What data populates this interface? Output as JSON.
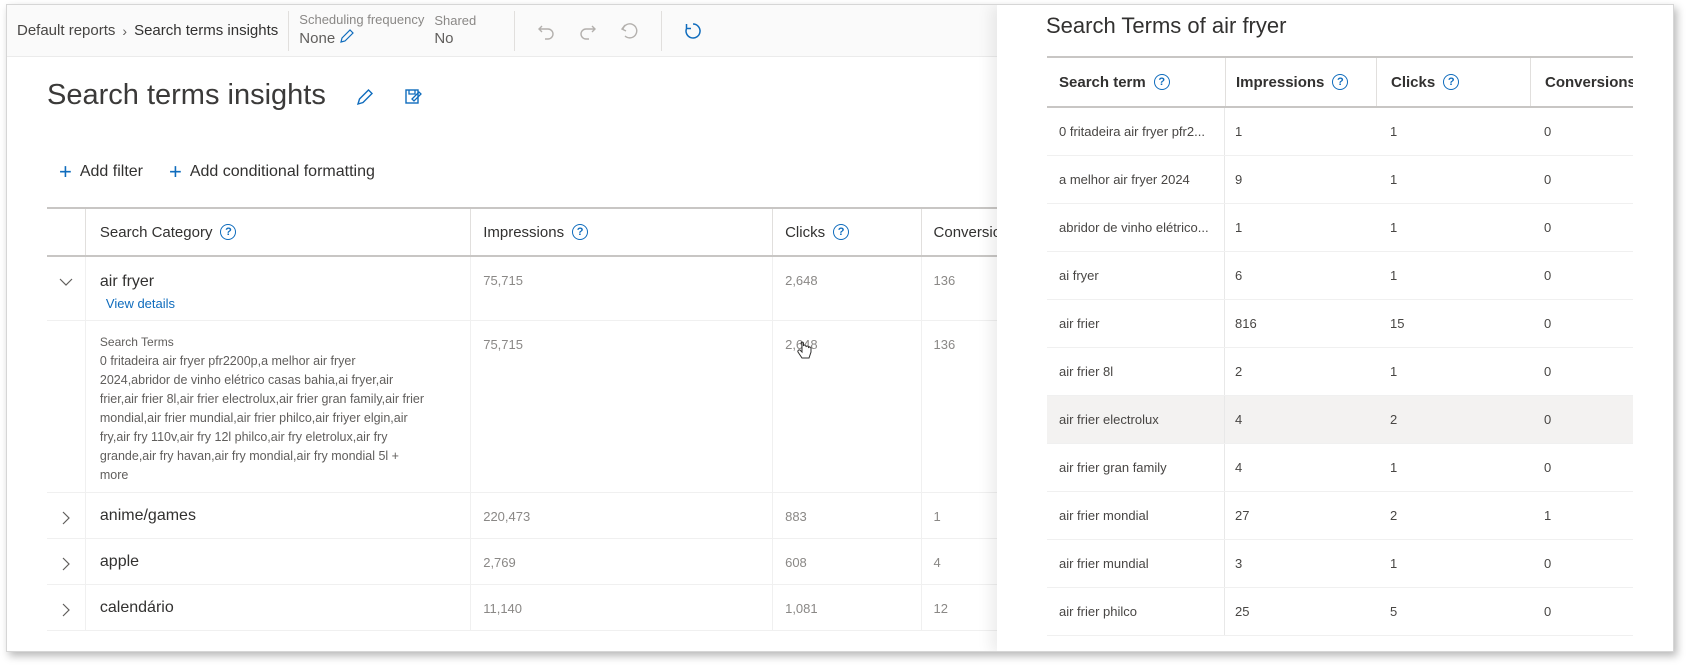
{
  "breadcrumb": {
    "parent": "Default reports",
    "current": "Search terms insights"
  },
  "scheduling": {
    "label": "Scheduling frequency",
    "value": "None"
  },
  "shared": {
    "label": "Shared",
    "value": "No"
  },
  "page": {
    "title": "Search terms insights"
  },
  "actions": {
    "add_filter": "Add filter",
    "add_conditional": "Add conditional formatting"
  },
  "grid": {
    "headers": {
      "category": "Search Category",
      "impressions": "Impressions",
      "clicks": "Clicks",
      "conversions": "Conversions"
    },
    "rows": [
      {
        "category": "air fryer",
        "view_details": "View details",
        "impressions": "75,715",
        "clicks": "2,648",
        "conversions": "136"
      },
      {
        "category": "anime/games",
        "impressions": "220,473",
        "clicks": "883",
        "conversions": "1"
      },
      {
        "category": "apple",
        "impressions": "2,769",
        "clicks": "608",
        "conversions": "4"
      },
      {
        "category": "calendário",
        "impressions": "11,140",
        "clicks": "1,081",
        "conversions": "12"
      }
    ],
    "expanded": {
      "title": "Search Terms",
      "text": "0 fritadeira air fryer pfr2200p,a melhor air fryer 2024,abridor de vinho elétrico casas bahia,ai fryer,air frier,air frier 8l,air frier electrolux,air frier gran family,air frier mondial,air frier mundial,air frier philco,air friyer elgin,air fry,air fry 110v,air fry 12l philco,air fry eletrolux,air fry grande,air fry havan,air fry mondial,air fry mondial 5l + more",
      "impressions": "75,715",
      "clicks": "2,648",
      "conversions": "136"
    }
  },
  "panel": {
    "title": "Search Terms of air fryer",
    "headers": {
      "term": "Search term",
      "impressions": "Impressions",
      "clicks": "Clicks",
      "conversions": "Conversions"
    },
    "rows": [
      {
        "term": "0 fritadeira air fryer pfr2...",
        "impressions": "1",
        "clicks": "1",
        "conversions": "0"
      },
      {
        "term": "a melhor air fryer 2024",
        "impressions": "9",
        "clicks": "1",
        "conversions": "0"
      },
      {
        "term": "abridor de vinho elétrico...",
        "impressions": "1",
        "clicks": "1",
        "conversions": "0"
      },
      {
        "term": "ai fryer",
        "impressions": "6",
        "clicks": "1",
        "conversions": "0"
      },
      {
        "term": "air frier",
        "impressions": "816",
        "clicks": "15",
        "conversions": "0"
      },
      {
        "term": "air frier 8l",
        "impressions": "2",
        "clicks": "1",
        "conversions": "0"
      },
      {
        "term": "air frier electrolux",
        "impressions": "4",
        "clicks": "2",
        "conversions": "0"
      },
      {
        "term": "air frier gran family",
        "impressions": "4",
        "clicks": "1",
        "conversions": "0"
      },
      {
        "term": "air frier mondial",
        "impressions": "27",
        "clicks": "2",
        "conversions": "1"
      },
      {
        "term": "air frier mundial",
        "impressions": "3",
        "clicks": "1",
        "conversions": "0"
      },
      {
        "term": "air frier philco",
        "impressions": "25",
        "clicks": "5",
        "conversions": "0"
      }
    ]
  },
  "colors": {
    "accent": "#0f6cbd",
    "text": "#323130",
    "muted": "#8a8886"
  }
}
